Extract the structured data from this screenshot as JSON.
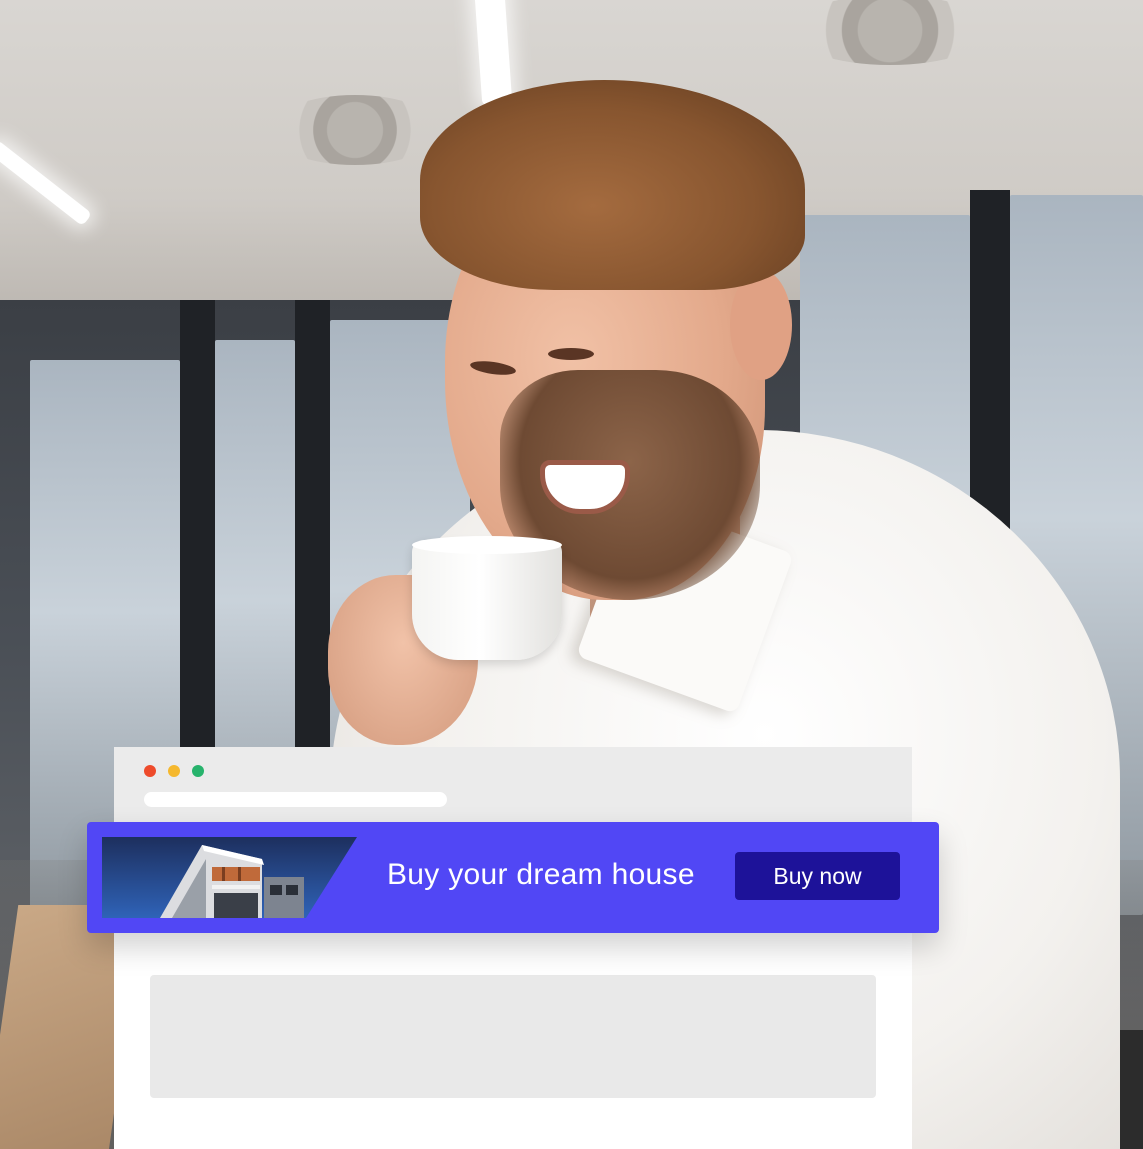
{
  "browser": {
    "window_controls": [
      {
        "name": "close",
        "color": "#ee4b2b"
      },
      {
        "name": "minimize",
        "color": "#f5b82e"
      },
      {
        "name": "maximize",
        "color": "#27b36c"
      }
    ]
  },
  "banner": {
    "headline": "Buy your dream house",
    "cta_label": "Buy now",
    "image_icon": "building-photo",
    "background_color": "#5147f5",
    "cta_color": "#1d1299"
  },
  "photo": {
    "subject": "man-drinking-coffee-photo"
  }
}
